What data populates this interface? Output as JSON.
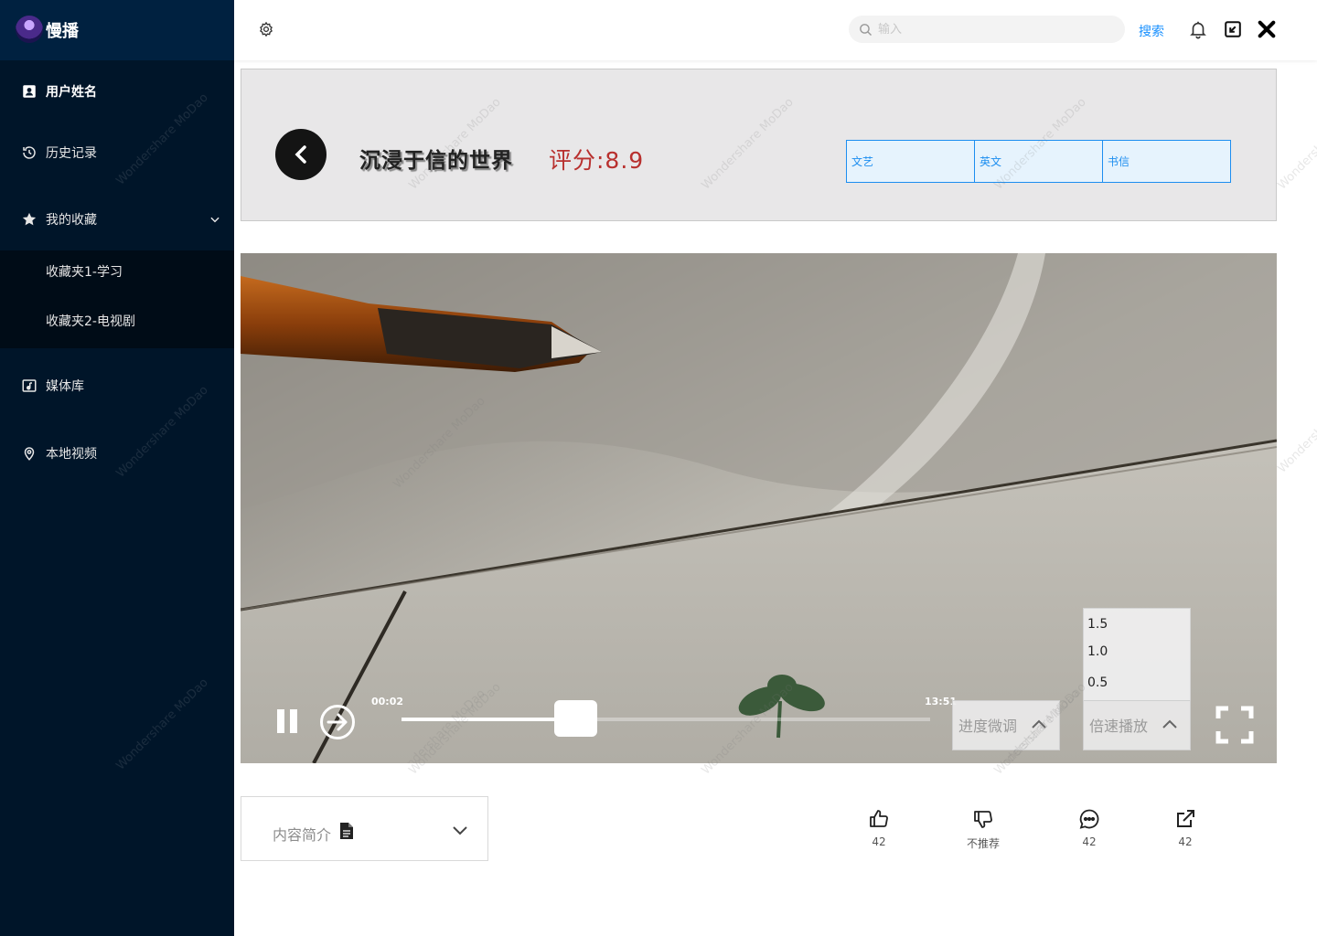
{
  "app": {
    "name": "慢播"
  },
  "sidebar": {
    "user": "用户姓名",
    "history": "历史记录",
    "favorites": {
      "label": "我的收藏",
      "folders": [
        "收藏夹1-学习",
        "收藏夹2-电视剧"
      ]
    },
    "library": "媒体库",
    "local": "本地视频"
  },
  "header": {
    "search_placeholder": "输入",
    "search_label": "搜索"
  },
  "video_info": {
    "title": "沉浸于信的世界",
    "rating": "评分:8.9",
    "tags": [
      "文艺",
      "英文",
      "书信"
    ]
  },
  "player": {
    "time_current": "00:02",
    "time_total": "13:51",
    "progress_fraction": 0.33,
    "fine_tune_label": "进度微调",
    "speed_label": "倍速播放",
    "speed_options": [
      "1.5",
      "1.0",
      "0.5"
    ]
  },
  "intro": {
    "label": "内容简介"
  },
  "actions": {
    "like_count": "42",
    "dislike_label": "不推荐",
    "comment_count": "42",
    "share_count": "42"
  },
  "watermark": "Wondershare MoDao"
}
